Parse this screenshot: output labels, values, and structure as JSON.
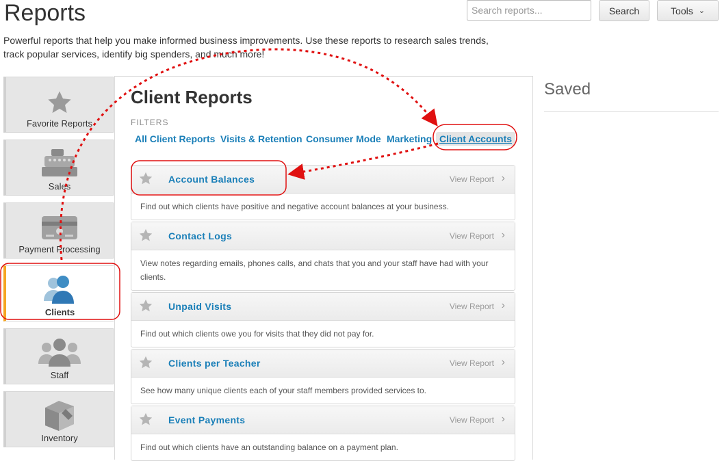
{
  "header": {
    "title": "Reports",
    "search_placeholder": "Search reports...",
    "search_label": "Search",
    "tools_label": "Tools",
    "intro": "Powerful reports that help you make informed business improvements. Use these reports to research sales trends, track popular services, identify big spenders, and much more!"
  },
  "sidebar": {
    "items": [
      {
        "label": "Favorite Reports",
        "icon": "star-icon"
      },
      {
        "label": "Sales",
        "icon": "cash-register-icon"
      },
      {
        "label": "Payment Processing",
        "icon": "credit-card-icon"
      },
      {
        "label": "Clients",
        "icon": "clients-icon",
        "active": true
      },
      {
        "label": "Staff",
        "icon": "staff-icon"
      },
      {
        "label": "Inventory",
        "icon": "inventory-box-icon"
      }
    ]
  },
  "main": {
    "title": "Client Reports",
    "filters_label": "FILTERS",
    "filters": [
      "All Client Reports",
      "Visits & Retention",
      "Consumer Mode",
      "Marketing",
      "Client Accounts"
    ],
    "active_filter": "Client Accounts",
    "view_label": "View Report",
    "reports": [
      {
        "title": "Account Balances",
        "desc": "Find out which clients have positive and negative account balances at your business."
      },
      {
        "title": "Contact Logs",
        "desc": "View notes regarding emails, phones calls, and chats that you and your staff have had with your clients."
      },
      {
        "title": "Unpaid Visits",
        "desc": "Find out which clients owe you for visits that they did not pay for."
      },
      {
        "title": "Clients per Teacher",
        "desc": "See how many unique clients each of your staff members provided services to."
      },
      {
        "title": "Event Payments",
        "desc": "Find out which clients have an outstanding balance on a payment plan."
      }
    ]
  },
  "saved": {
    "title": "Saved"
  },
  "colors": {
    "accent": "#1a7fb8",
    "active_tab": "#f5a623",
    "annotation": "#e01010"
  }
}
